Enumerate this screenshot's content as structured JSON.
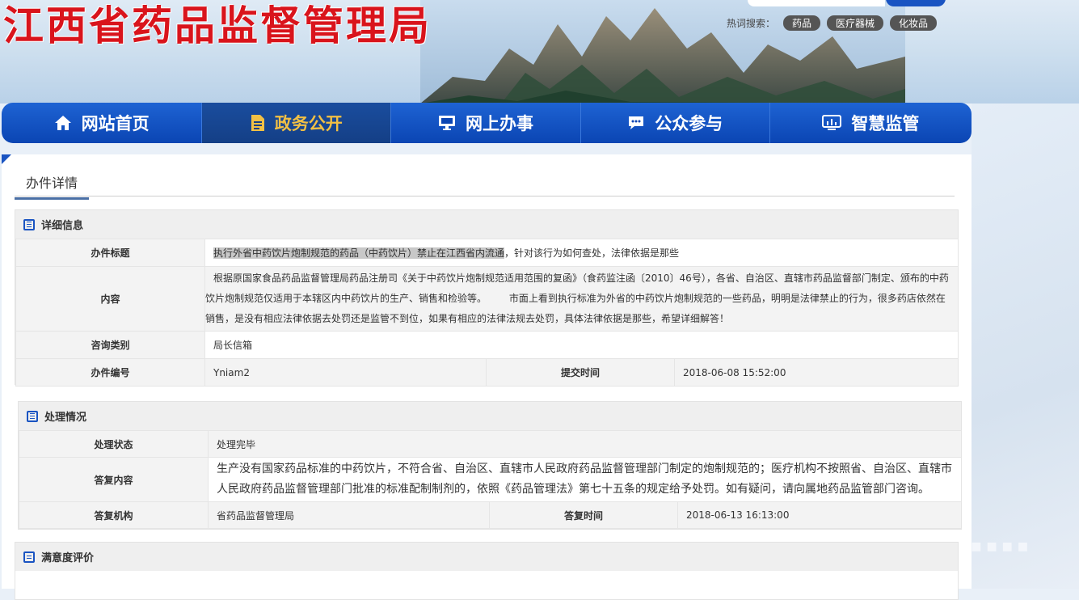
{
  "header": {
    "site_title": "江西省药品监督管理局",
    "hot_search_label": "热词搜索：",
    "hot_tags": [
      "药品",
      "医疗器械",
      "化妆品"
    ]
  },
  "nav": {
    "items": [
      {
        "label": "网站首页",
        "icon": "home-icon"
      },
      {
        "label": "政务公开",
        "icon": "document-icon",
        "active": true
      },
      {
        "label": "网上办事",
        "icon": "monitor-icon"
      },
      {
        "label": "公众参与",
        "icon": "chat-icon"
      },
      {
        "label": "智慧监管",
        "icon": "chart-screen-icon"
      }
    ]
  },
  "page": {
    "title": "办件详情"
  },
  "details": {
    "heading": "详细信息",
    "title_label": "办件标题",
    "title_value_highlight": "执行外省中药饮片炮制规范的药品（中药饮片）禁止在江西省内流通",
    "title_value_rest": "，针对该行为如何查处，法律依据是那些",
    "content_label": "内容",
    "content_value": "根据原国家食品药品监督管理局药品注册司《关于中药饮片炮制规范适用范围的复函》（食药监注函〔2010〕46号），各省、自治区、直辖市药品监督部门制定、颁布的中药饮片炮制规范仅适用于本辖区内中药饮片的生产、销售和检验等。 　　市面上看到执行标准为外省的中药饮片炮制规范的一些药品，明明是法律禁止的行为，很多药店依然在销售，是没有相应法律依据去处罚还是监管不到位，如果有相应的法律法规去处罚，具体法律依据是那些，希望详细解答！",
    "category_label": "咨询类别",
    "category_value": "局长信箱",
    "number_label": "办件编号",
    "number_value": "Yniam2",
    "submit_time_label": "提交时间",
    "submit_time_value": "2018-06-08 15:52:00"
  },
  "handling": {
    "heading": "处理情况",
    "status_label": "处理状态",
    "status_value": "处理完毕",
    "reply_label": "答复内容",
    "reply_value": "生产没有国家药品标准的中药饮片，不符合省、自治区、直辖市人民政府药品监督管理部门制定的炮制规范的；医疗机构不按照省、自治区、直辖市人民政府药品监督管理部门批准的标准配制制剂的，依照《药品管理法》第七十五条的规定给予处罚。如有疑问，请向属地药品监管部门咨询。",
    "org_label": "答复机构",
    "org_value": "省药品监督管理局",
    "reply_time_label": "答复时间",
    "reply_time_value": "2018-06-13 16:13:00"
  },
  "rating": {
    "heading": "满意度评价"
  },
  "colors": {
    "nav_blue": "#1a54c2",
    "title_red": "#d9141c",
    "active_gold": "#f2c044"
  }
}
